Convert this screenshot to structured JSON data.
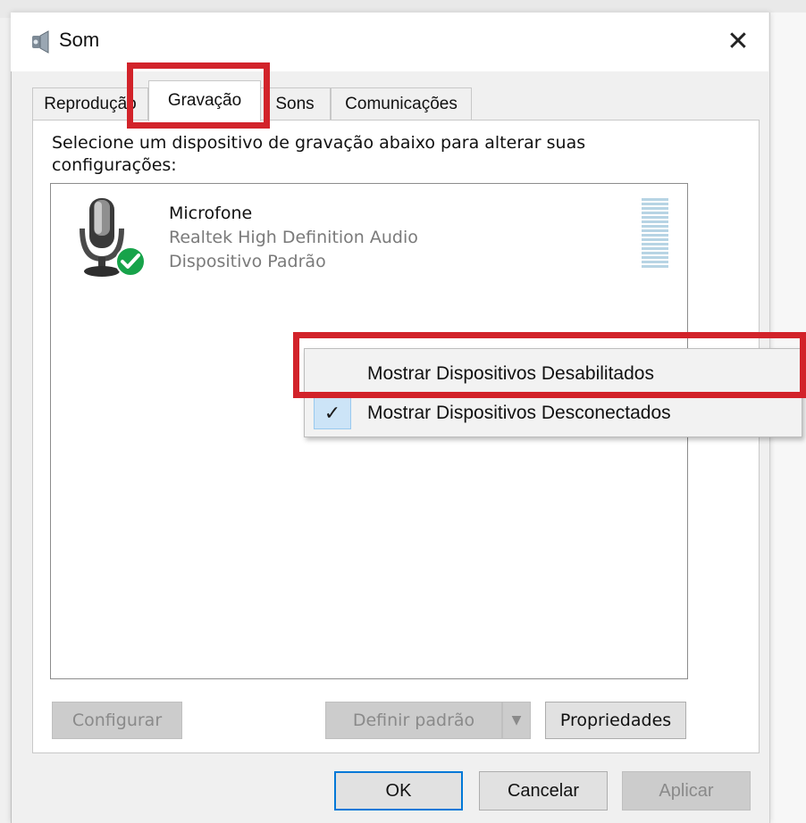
{
  "window": {
    "title": "Som",
    "close_label": "✕"
  },
  "tabs": [
    {
      "label": "Reprodução",
      "selected": false
    },
    {
      "label": "Gravação",
      "selected": true
    },
    {
      "label": "Sons",
      "selected": false
    },
    {
      "label": "Comunicações",
      "selected": false
    }
  ],
  "instructions": "Selecione um dispositivo de gravação abaixo para alterar suas configurações:",
  "devices": [
    {
      "name": "Microfone",
      "driver": "Realtek High Definition Audio",
      "status": "Dispositivo Padrão",
      "icon": "microphone-icon",
      "default_badge": "check-badge-icon"
    }
  ],
  "context_menu": {
    "items": [
      {
        "label": "Mostrar Dispositivos Desabilitados",
        "checked": false
      },
      {
        "label": "Mostrar Dispositivos Desconectados",
        "checked": true
      }
    ]
  },
  "buttons": {
    "configurar": "Configurar",
    "definir_padrao": "Definir padrão",
    "propriedades": "Propriedades",
    "ok": "OK",
    "cancelar": "Cancelar",
    "aplicar": "Aplicar"
  },
  "colors": {
    "highlight_red": "#d2232a",
    "accent_blue": "#0078d7",
    "check_green": "#17a34a"
  }
}
